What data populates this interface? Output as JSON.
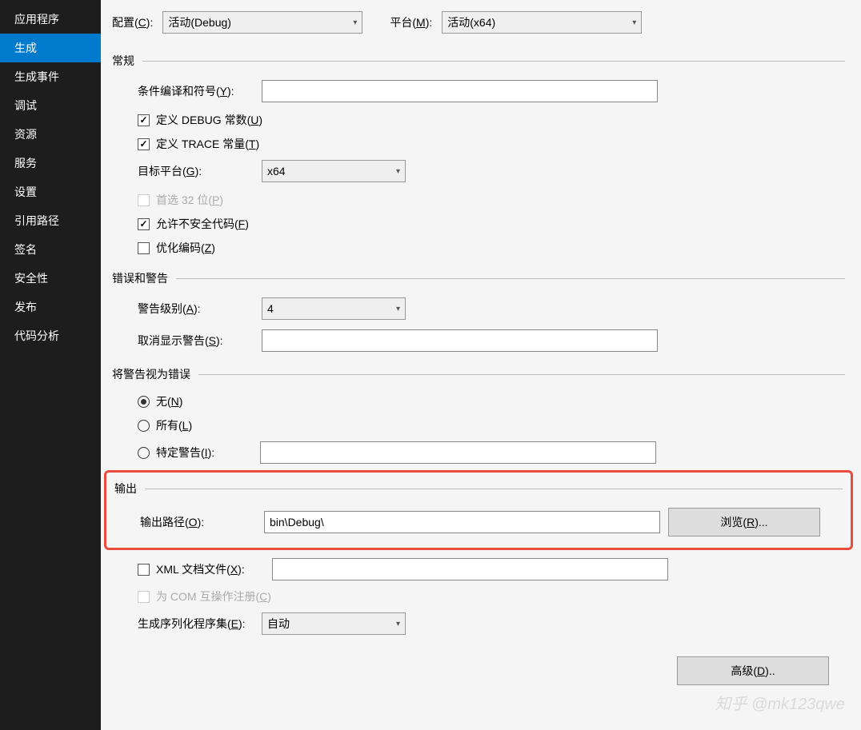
{
  "sidebar": {
    "items": [
      "应用程序",
      "生成",
      "生成事件",
      "调试",
      "资源",
      "服务",
      "设置",
      "引用路径",
      "签名",
      "安全性",
      "发布",
      "代码分析"
    ],
    "selected": 1
  },
  "topbar": {
    "config_label_pre": "配置(",
    "config_hot": "C",
    "config_label_post": "):",
    "config_value": "活动(Debug)",
    "platform_label_pre": "平台(",
    "platform_hot": "M",
    "platform_label_post": "):",
    "platform_value": "活动(x64)"
  },
  "sections": {
    "general": "常规",
    "errors": "错误和警告",
    "treat_as_error": "将警告视为错误",
    "output": "输出"
  },
  "general": {
    "symbols_pre": "条件编译和符号(",
    "symbols_hot": "Y",
    "symbols_post": "):",
    "symbols_value": "",
    "debug_const_pre": "定义 DEBUG 常数(",
    "debug_const_hot": "U",
    "debug_const_post": ")",
    "trace_const_pre": "定义 TRACE 常量(",
    "trace_const_hot": "T",
    "trace_const_post": ")",
    "target_pre": "目标平台(",
    "target_hot": "G",
    "target_post": "):",
    "target_value": "x64",
    "prefer32_pre": "首选 32 位(",
    "prefer32_hot": "P",
    "prefer32_post": ")",
    "unsafe_pre": "允许不安全代码(",
    "unsafe_hot": "F",
    "unsafe_post": ")",
    "optimize_pre": "优化编码(",
    "optimize_hot": "Z",
    "optimize_post": ")"
  },
  "errors": {
    "level_pre": "警告级别(",
    "level_hot": "A",
    "level_post": "):",
    "level_value": "4",
    "suppress_pre": "取消显示警告(",
    "suppress_hot": "S",
    "suppress_post": "):",
    "suppress_value": ""
  },
  "treat": {
    "none_pre": "无(",
    "none_hot": "N",
    "none_post": ")",
    "all_pre": "所有(",
    "all_hot": "L",
    "all_post": ")",
    "specific_pre": "特定警告(",
    "specific_hot": "I",
    "specific_post": "):",
    "specific_value": ""
  },
  "output": {
    "path_pre": "输出路径(",
    "path_hot": "O",
    "path_post": "):",
    "path_value": "bin\\Debug\\",
    "browse_pre": "浏览(",
    "browse_hot": "R",
    "browse_post": ")...",
    "xml_pre": "XML 文档文件(",
    "xml_hot": "X",
    "xml_post": "):",
    "com_pre": "为 COM 互操作注册(",
    "com_hot": "C",
    "com_post": ")",
    "serial_pre": "生成序列化程序集(",
    "serial_hot": "E",
    "serial_post": "):",
    "serial_value": "自动"
  },
  "advanced": {
    "pre": "高级(",
    "hot": "D",
    "post": ").."
  },
  "watermark": "知乎 @mk123qwe"
}
